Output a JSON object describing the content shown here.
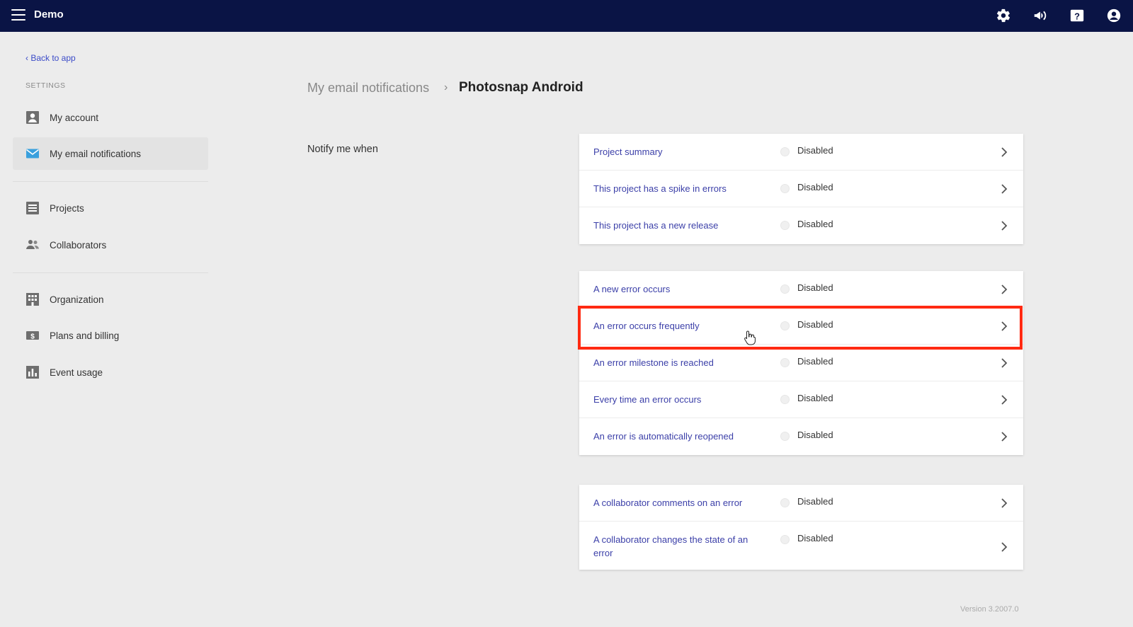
{
  "header": {
    "app_name": "Demo",
    "icons": [
      "menu-icon",
      "gear-icon",
      "megaphone-icon",
      "help-icon",
      "user-icon"
    ]
  },
  "sidebar": {
    "back_link": "‹ Back to app",
    "section_label": "SETTINGS",
    "items": [
      {
        "label": "My account",
        "icon": "person-icon"
      },
      {
        "label": "My email notifications",
        "icon": "envelope-icon",
        "active": true
      },
      {
        "label": "Projects",
        "icon": "list-icon"
      },
      {
        "label": "Collaborators",
        "icon": "people-icon"
      },
      {
        "label": "Organization",
        "icon": "building-icon"
      },
      {
        "label": "Plans and billing",
        "icon": "dollar-icon"
      },
      {
        "label": "Event usage",
        "icon": "bar-chart-icon"
      }
    ]
  },
  "main": {
    "breadcrumb_parent": "My email notifications",
    "breadcrumb_separator": "›",
    "breadcrumb_current": "Photosnap Android",
    "section_label": "Notify me when",
    "groups": [
      {
        "rows": [
          {
            "label": "Project summary",
            "status": "Disabled"
          },
          {
            "label": "This project has a spike in errors",
            "status": "Disabled"
          },
          {
            "label": "This project has a new release",
            "status": "Disabled"
          }
        ]
      },
      {
        "rows": [
          {
            "label": "A new error occurs",
            "status": "Disabled"
          },
          {
            "label": "An error occurs frequently",
            "status": "Disabled",
            "highlighted": true
          },
          {
            "label": "An error milestone is reached",
            "status": "Disabled"
          },
          {
            "label": "Every time an error occurs",
            "status": "Disabled"
          },
          {
            "label": "An error is automatically reopened",
            "status": "Disabled"
          }
        ]
      },
      {
        "rows": [
          {
            "label": "A collaborator comments on an error",
            "status": "Disabled"
          },
          {
            "label": "A collaborator changes the state of an error",
            "status": "Disabled"
          }
        ]
      }
    ]
  },
  "footer": {
    "version": "Version 3.2007.0"
  },
  "colors": {
    "topbar": "#0a1445",
    "link": "#3b3fa8",
    "highlight": "#ff2a12",
    "active_nav_icon": "#3aa0dd"
  }
}
